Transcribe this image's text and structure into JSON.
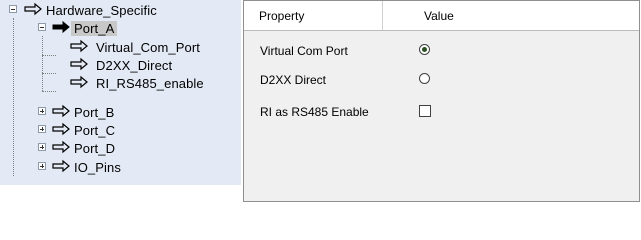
{
  "tree": {
    "root": "Hardware_Specific",
    "selected": "Port_A",
    "port_a_children": [
      "Virtual_Com_Port",
      "D2XX_Direct",
      "RI_RS485_enable"
    ],
    "other_ports": [
      "Port_B",
      "Port_C",
      "Port_D",
      "IO_Pins"
    ],
    "icons": {
      "node": "arrow-right-icon",
      "expand": "plus-icon",
      "collapse": "minus-icon"
    }
  },
  "grid": {
    "header": {
      "property": "Property",
      "value": "Value"
    },
    "rows": [
      {
        "name": "Virtual Com Port",
        "control": "radio",
        "checked": true
      },
      {
        "name": "D2XX Direct",
        "control": "radio",
        "checked": false
      },
      {
        "name": "RI as RS485 Enable",
        "control": "checkbox",
        "checked": false
      }
    ]
  },
  "colors": {
    "tree_bg": "#e4eaf5",
    "selected_bg": "#c8c8c8",
    "grid_bg": "#f0f0f0"
  }
}
